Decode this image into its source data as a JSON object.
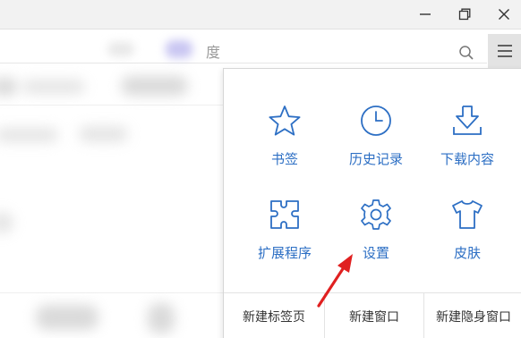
{
  "window": {
    "minimize_icon": "minimize-icon",
    "restore_icon": "restore-icon",
    "close_icon": "close-icon"
  },
  "address_bar": {
    "partial_text": "度",
    "search_icon": "search-icon"
  },
  "menu_button_icon": "hamburger-menu-icon",
  "menu": {
    "items": [
      {
        "label": "书签",
        "icon": "star-icon"
      },
      {
        "label": "历史记录",
        "icon": "clock-icon"
      },
      {
        "label": "下载内容",
        "icon": "download-icon"
      },
      {
        "label": "扩展程序",
        "icon": "puzzle-icon"
      },
      {
        "label": "设置",
        "icon": "gear-icon"
      },
      {
        "label": "皮肤",
        "icon": "tshirt-icon"
      }
    ],
    "bottom": [
      {
        "label": "新建标签页"
      },
      {
        "label": "新建窗口"
      },
      {
        "label": "新建隐身窗口"
      }
    ]
  },
  "colors": {
    "accent": "#2d6fc4",
    "arrow": "#e02020"
  }
}
